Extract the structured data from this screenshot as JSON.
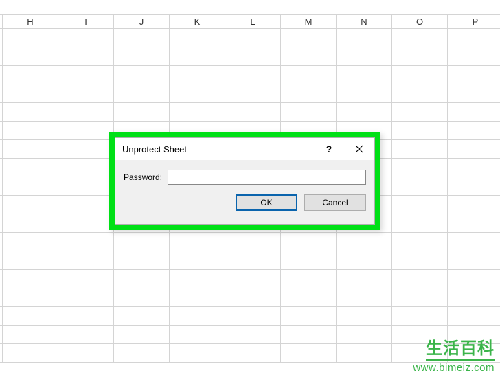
{
  "columns": [
    "H",
    "I",
    "J",
    "K",
    "L",
    "M",
    "N",
    "O",
    "P"
  ],
  "rowCount": 18,
  "dialog": {
    "title": "Unprotect Sheet",
    "helpSymbol": "?",
    "passwordLabelPrefix": "P",
    "passwordLabelRest": "assword:",
    "passwordValue": "",
    "okLabel": "OK",
    "cancelLabel": "Cancel"
  },
  "watermark": {
    "brand": "生活百科",
    "url": "www.bimeiz.com"
  }
}
